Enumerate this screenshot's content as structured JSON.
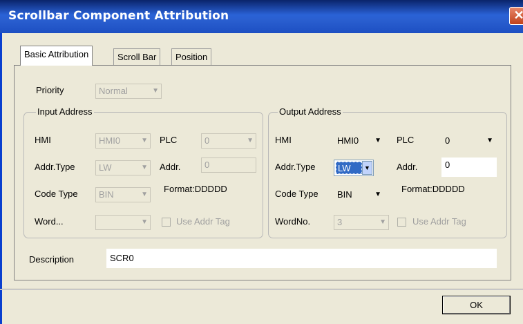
{
  "window": {
    "title": "Scrollbar Component Attribution",
    "close_glyph": "✕"
  },
  "tabs": [
    {
      "label": "Basic Attribution",
      "active": true
    },
    {
      "label": "Scroll Bar",
      "active": false
    },
    {
      "label": "Position",
      "active": false
    }
  ],
  "priority": {
    "label": "Priority",
    "value": "Normal"
  },
  "input_address": {
    "title": "Input Address",
    "hmi_label": "HMI",
    "hmi_value": "HMI0",
    "plc_label": "PLC",
    "plc_value": "0",
    "addr_type_label": "Addr.Type",
    "addr_type_value": "LW",
    "addr_label": "Addr.",
    "addr_value": "0",
    "code_type_label": "Code Type",
    "code_type_value": "BIN",
    "format_text": "Format:DDDDD",
    "word_label": "Word...",
    "word_value": "",
    "use_tag_label": "Use Addr Tag"
  },
  "output_address": {
    "title": "Output Address",
    "hmi_label": "HMI",
    "hmi_value": "HMI0",
    "plc_label": "PLC",
    "plc_value": "0",
    "addr_type_label": "Addr.Type",
    "addr_type_value": "LW",
    "addr_label": "Addr.",
    "addr_value": "0",
    "code_type_label": "Code Type",
    "code_type_value": "BIN",
    "format_text": "Format:DDDDD",
    "wordno_label": "WordNo.",
    "wordno_value": "3",
    "use_tag_label": "Use Addr Tag"
  },
  "description": {
    "label": "Description",
    "value": "SCR0"
  },
  "ok_label": "OK",
  "icons": {
    "dropdown": "▼"
  },
  "colors": {
    "title_bar": "#2a62d6",
    "selection": "#316ac5",
    "close": "#c1421c"
  }
}
